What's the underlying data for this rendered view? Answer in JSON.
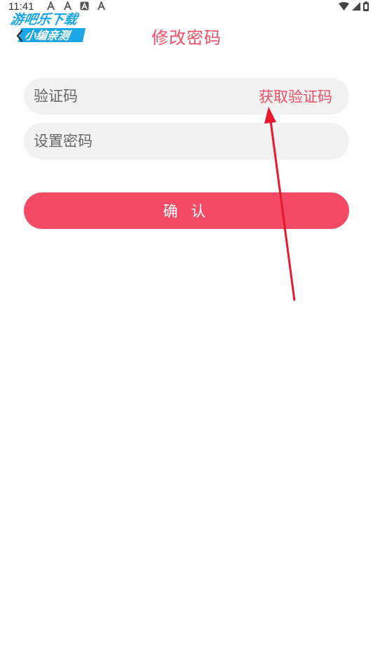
{
  "status_bar": {
    "time": "11:41",
    "notification_icons": [
      "a-icon",
      "a-icon",
      "a-box-icon",
      "a-icon"
    ],
    "right_icons": [
      "wifi-icon",
      "signal-icon",
      "battery-icon"
    ]
  },
  "watermark": {
    "line1": "游吧乐下载",
    "line2": "小编亲测"
  },
  "header": {
    "title": "修改密码",
    "back_icon": "chevron-left-icon"
  },
  "form": {
    "code_placeholder": "验证码",
    "code_value": "",
    "get_code_label": "获取验证码",
    "password_placeholder": "设置密码",
    "password_value": "",
    "confirm_label": "确 认"
  },
  "colors": {
    "accent": "#f14d66",
    "button": "#f54a65",
    "input_bg": "#f1f1f1",
    "annotation_arrow": "#e8192c"
  }
}
